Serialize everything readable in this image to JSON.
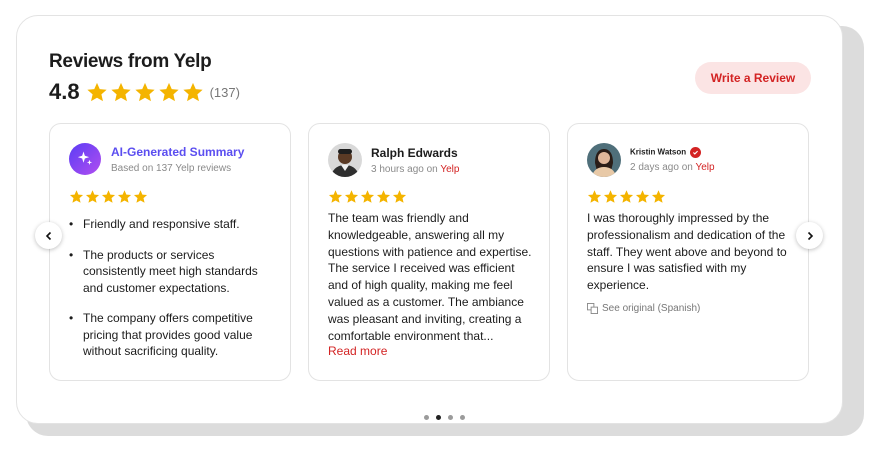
{
  "header": {
    "title": "Reviews from Yelp",
    "rating": "4.8",
    "count": "(137)",
    "write_review_label": "Write a Review"
  },
  "colors": {
    "brand": "#d32323",
    "star": "#f4b400",
    "ai_accent": "#5b4ef0"
  },
  "cards": [
    {
      "name": "AI-Generated Summary",
      "sub": "Based on 137 Yelp reviews",
      "icon": "sparkle-icon",
      "stars": 5,
      "bullets": [
        "Friendly and responsive staff.",
        "The products or services consistently meet high standards and customer expectations.",
        "The company offers competitive pricing that provides good value without sacrificing quality."
      ]
    },
    {
      "name": "Ralph Edwards",
      "time": "3 hours ago on",
      "source": "Yelp",
      "stars": 5,
      "text": "The team was friendly and knowledgeable, answering all my questions with patience and expertise. The service I received was efficient and of high quality, making me feel valued as a customer. The ambiance was pleasant and inviting, creating a comfortable environment that...",
      "read_more": "Read more"
    },
    {
      "name": "Kristin Watson",
      "time": "2 days ago on",
      "source": "Yelp",
      "stars": 5,
      "text": "I was thoroughly impressed by the professionalism and dedication of the staff. They went above and beyond to ensure I was satisfied with my experience.",
      "see_original": "See original (Spanish)"
    }
  ],
  "pagination": {
    "total": 4,
    "active": 2
  }
}
